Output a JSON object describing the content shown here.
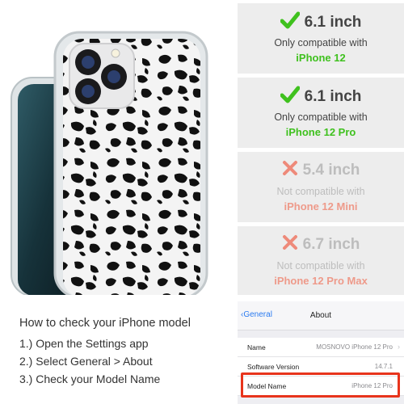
{
  "compatibility": [
    {
      "status": "ok",
      "mark": "check-icon",
      "size": "6.1 inch",
      "note": "Only compatible with",
      "model": "iPhone 12"
    },
    {
      "status": "ok",
      "mark": "check-icon",
      "size": "6.1 inch",
      "note": "Only compatible with",
      "model": "iPhone 12 Pro"
    },
    {
      "status": "no",
      "mark": "cross-icon",
      "size": "5.4 inch",
      "note": "Not compatible with",
      "model": "iPhone 12 Mini"
    },
    {
      "status": "no",
      "mark": "cross-icon",
      "size": "6.7 inch",
      "note": "Not compatible with",
      "model": "iPhone 12 Pro Max"
    }
  ],
  "howto": {
    "title": "How to check your iPhone model",
    "steps": [
      "1.) Open the Settings app",
      "2.) Select General > About",
      "3.) Check your Model Name"
    ]
  },
  "settings": {
    "back_label": "General",
    "title": "About",
    "rows": [
      {
        "label": "Name",
        "value": "MOSNOVO iPhone 12 Pro"
      },
      {
        "label": "Software Version",
        "value": "14.7.1"
      },
      {
        "label": "Model Name",
        "value": "iPhone 12 Pro"
      }
    ]
  },
  "colors": {
    "ok_mark": "#3fc11e",
    "no_mark": "#ee8a7a",
    "highlight": "#e8341c",
    "ios_blue": "#2b7bf0"
  }
}
